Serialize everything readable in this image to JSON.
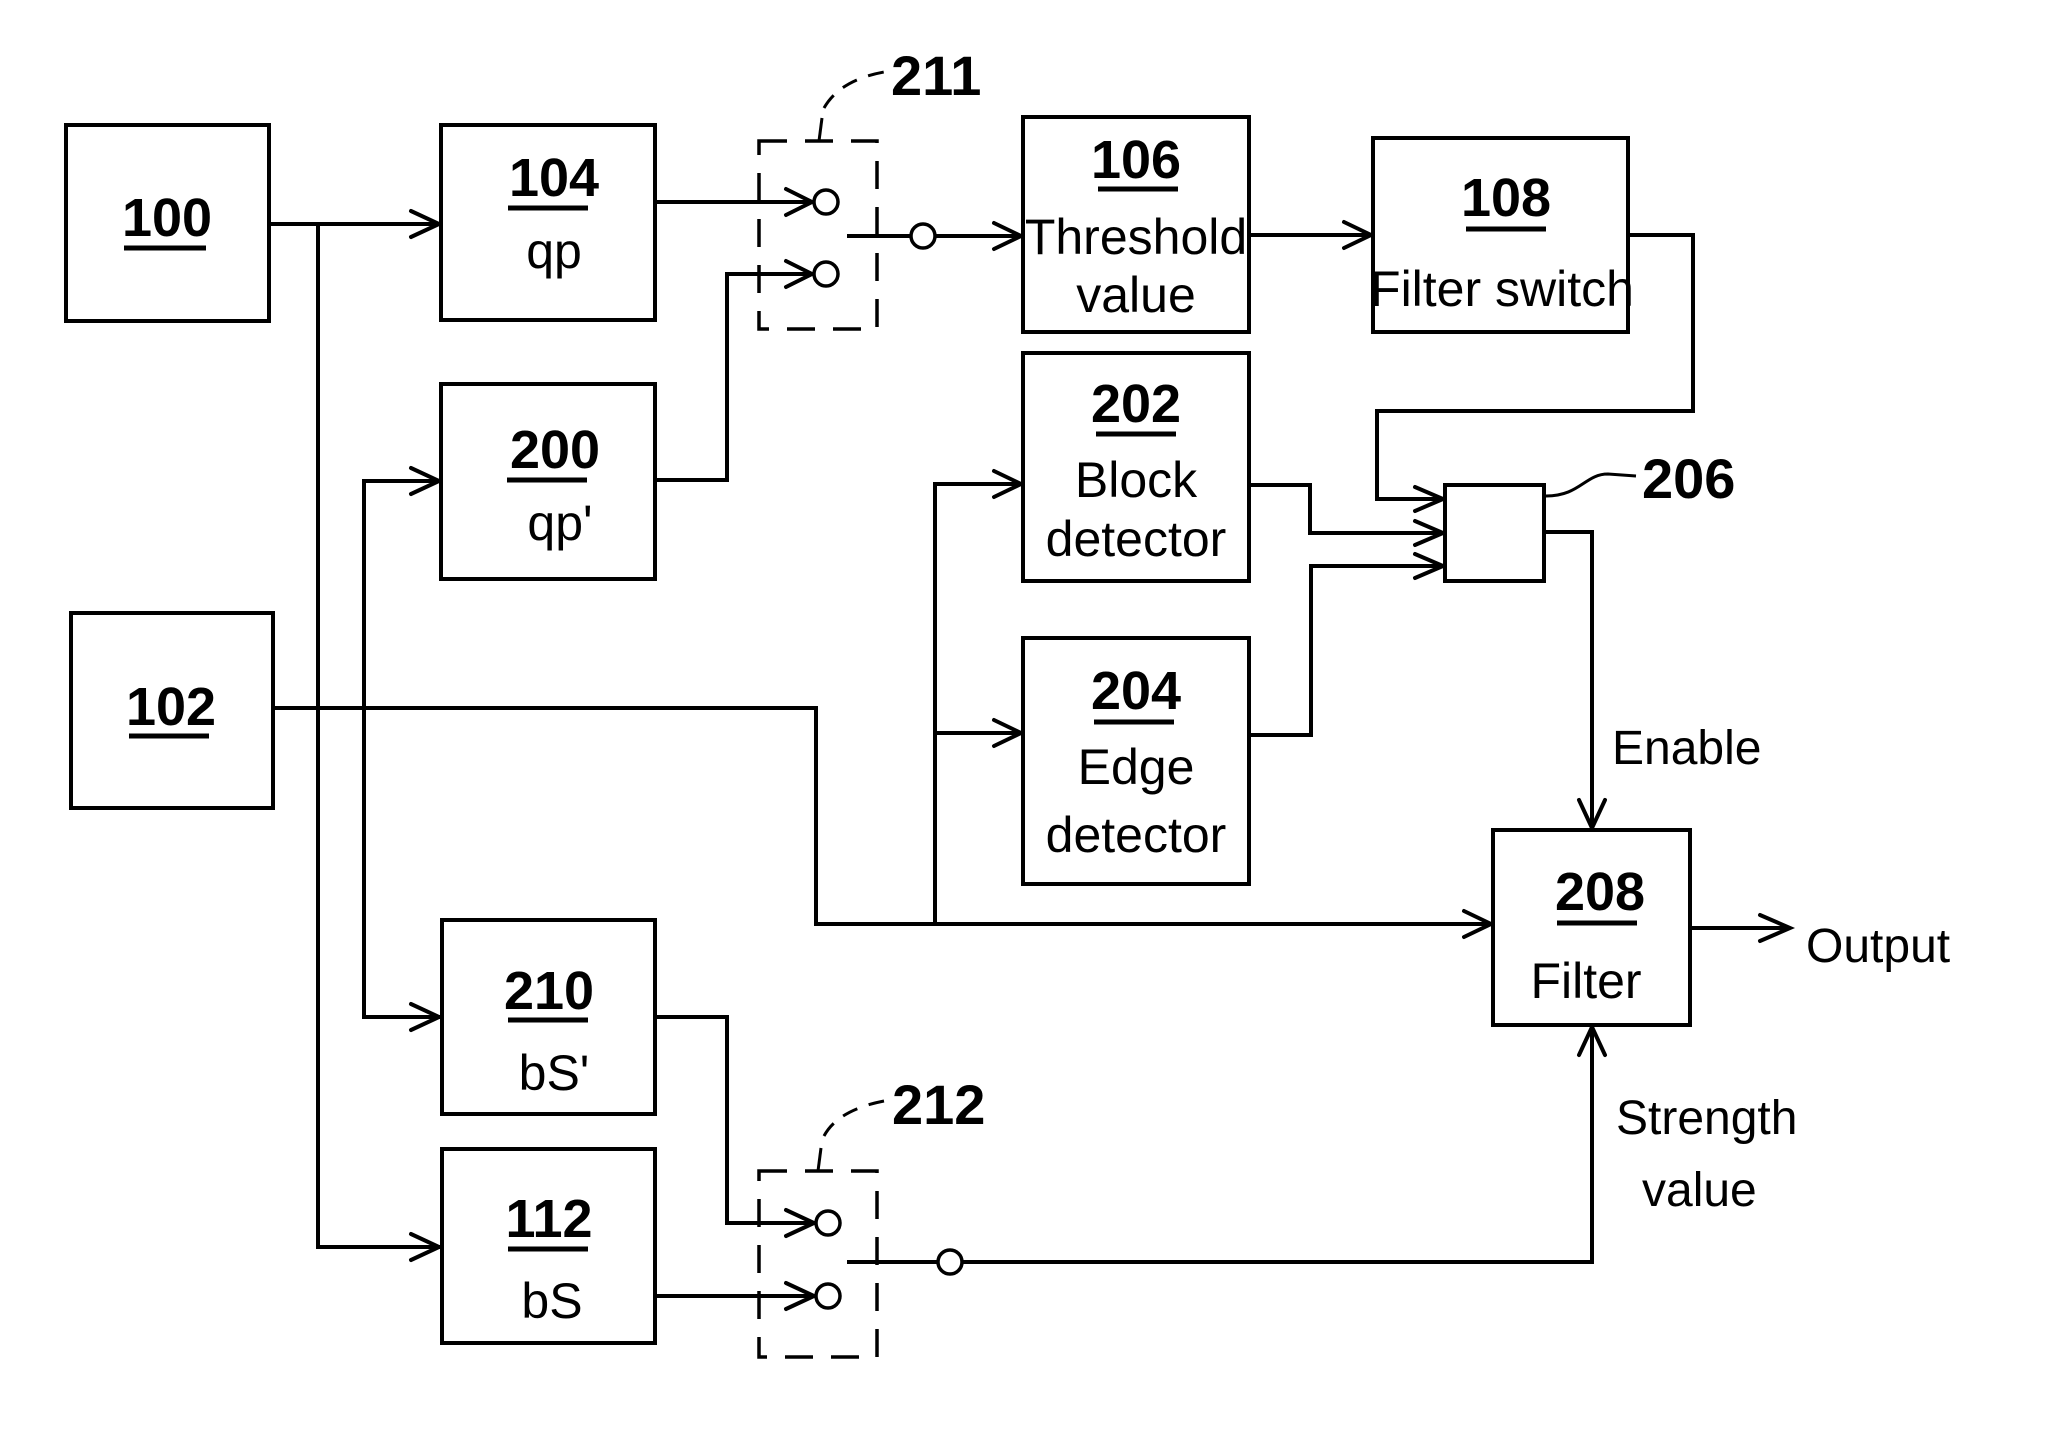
{
  "diagram": {
    "blocks": {
      "b100": {
        "ref": "100",
        "lines": []
      },
      "b102": {
        "ref": "102",
        "lines": []
      },
      "b104": {
        "ref": "104",
        "lines": [
          "qp"
        ]
      },
      "b200": {
        "ref": "200",
        "lines": [
          "qp'"
        ]
      },
      "b210": {
        "ref": "210",
        "lines": [
          "bS'"
        ]
      },
      "b112": {
        "ref": "112",
        "lines": [
          "bS"
        ]
      },
      "b106": {
        "ref": "106",
        "lines": [
          "Threshold",
          "value"
        ]
      },
      "b108": {
        "ref": "108",
        "lines": [
          "Filter switch"
        ]
      },
      "b202": {
        "ref": "202",
        "lines": [
          "Block",
          "detector"
        ]
      },
      "b204": {
        "ref": "204",
        "lines": [
          "Edge",
          "detector"
        ]
      },
      "b208": {
        "ref": "208",
        "lines": [
          "Filter"
        ]
      }
    },
    "callouts": {
      "switch_top": "211",
      "switch_bottom": "212",
      "and_gate": "206"
    },
    "signals": {
      "enable": "Enable",
      "output": "Output",
      "strength_line1": "Strength",
      "strength_line2": "value"
    }
  }
}
